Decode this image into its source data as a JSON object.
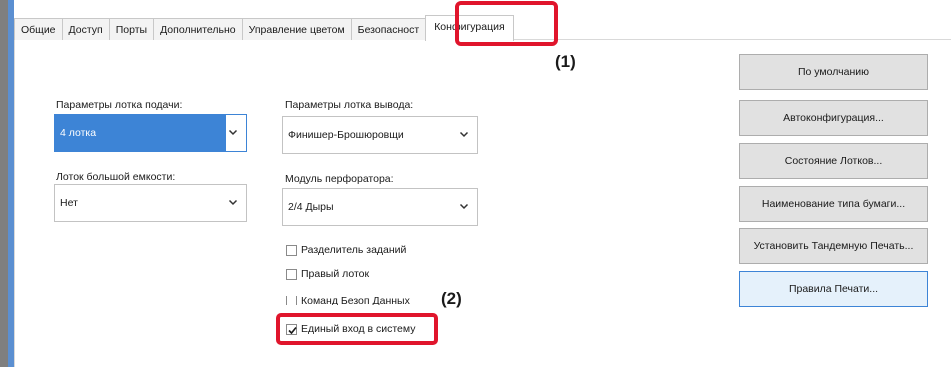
{
  "tabs": [
    {
      "label": "Общие"
    },
    {
      "label": "Доступ"
    },
    {
      "label": "Порты"
    },
    {
      "label": "Дополнительно"
    },
    {
      "label": "Управление цветом"
    },
    {
      "label": "Безопасност"
    },
    {
      "label": "Конфигурация",
      "active": true
    }
  ],
  "markers": {
    "m1": "(1)",
    "m2": "(2)"
  },
  "paper_tray": {
    "label": "Параметры лотка подачи:",
    "value": "4 лотка"
  },
  "high_capacity": {
    "label": "Лоток большой емкости:",
    "value": "Нет"
  },
  "output_tray": {
    "label": "Параметры лотка вывода:",
    "value": "Финишер-Брошюровщи"
  },
  "punch_module": {
    "label": "Модуль перфоратора:",
    "value": "2/4 Дыры"
  },
  "checkboxes": {
    "job_separator": {
      "label": "Разделитель заданий",
      "checked": false
    },
    "right_tray": {
      "label": "Правый лоток",
      "checked": false
    },
    "partial": {
      "label": "Команд Безоп Данных",
      "checked": false
    },
    "sso": {
      "label": "Единый вход в систему",
      "checked": true
    }
  },
  "buttons": {
    "defaults": "По умолчанию",
    "auto_config": "Автоконфигурация...",
    "tray_status": "Состояние Лотков...",
    "paper_type_name": "Наименование типа бумаги...",
    "tandem_print": "Установить Тандемную Печать...",
    "print_policy": "Правила Печати..."
  },
  "colors": {
    "accent": "#3d84d6",
    "highlight": "#e0152c"
  }
}
